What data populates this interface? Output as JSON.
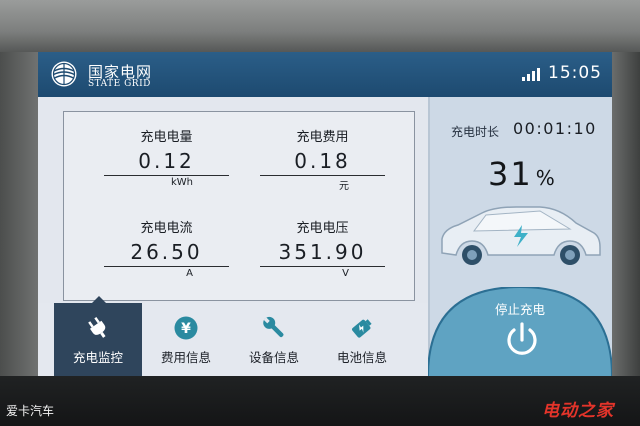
{
  "header": {
    "brand_cn": "国家电网",
    "brand_en": "STATE GRID",
    "time": "15:05",
    "logo_icon": "state-grid-logo",
    "signal_icon": "signal-bars-icon"
  },
  "readings": [
    {
      "label": "充电电量",
      "value": "0.12",
      "unit": "kWh"
    },
    {
      "label": "充电费用",
      "value": "0.18",
      "unit": "元"
    },
    {
      "label": "充电电流",
      "value": "26.50",
      "unit": "A"
    },
    {
      "label": "充电电压",
      "value": "351.90",
      "unit": "V"
    }
  ],
  "tabs": [
    {
      "label": "充电监控",
      "icon": "plug-icon",
      "active": true
    },
    {
      "label": "费用信息",
      "icon": "yen-coin-icon",
      "active": false
    },
    {
      "label": "设备信息",
      "icon": "wrench-icon",
      "active": false
    },
    {
      "label": "电池信息",
      "icon": "battery-icon",
      "active": false
    }
  ],
  "status": {
    "duration_label": "充电时长",
    "duration_value": "00:01:10",
    "percent": "31",
    "percent_sign": "%",
    "charge_fraction": 0.31,
    "car_icon": "electric-car-icon"
  },
  "stop": {
    "label": "停止充电",
    "icon": "power-icon"
  },
  "watermarks": {
    "left": "爱卡汽车",
    "right": "电动之家"
  },
  "colors": {
    "header": "#1d4a70",
    "active_tab": "#2f455c",
    "accent_teal": "#2a8aa0",
    "stop_panel": "#5fa3c2",
    "watermark_red": "#e3342a"
  }
}
